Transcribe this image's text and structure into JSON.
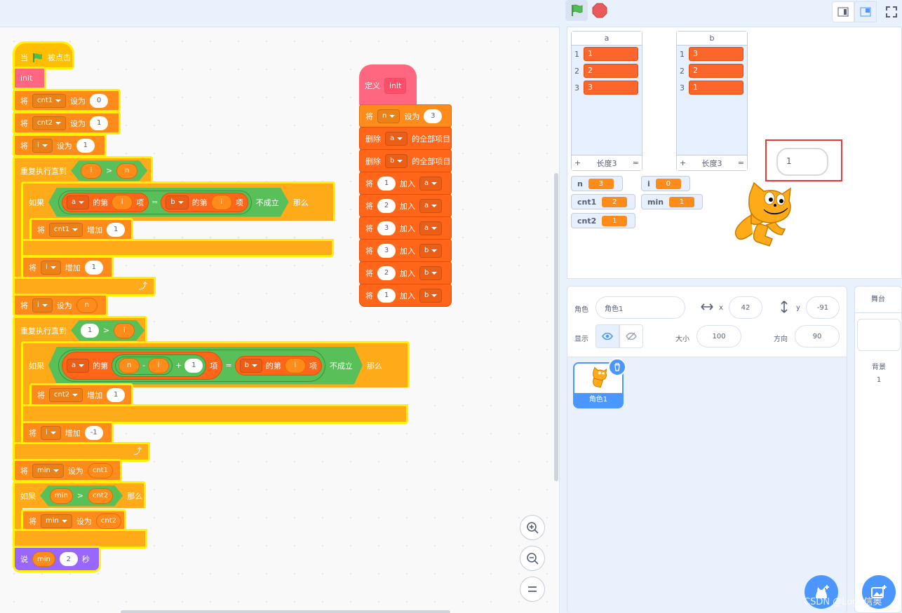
{
  "code": {
    "s1": {
      "hat": {
        "w1": "当",
        "w2": "被点击"
      },
      "init": "init",
      "set_cnt1": {
        "verb": "将",
        "var": "cnt1",
        "op": "设为",
        "val": "0"
      },
      "set_cnt2": {
        "verb": "将",
        "var": "cnt2",
        "op": "设为",
        "val": "1"
      },
      "set_i": {
        "verb": "将",
        "var": "i",
        "op": "设为",
        "val": "1"
      },
      "repeat1": {
        "label": "重复执行直到",
        "l": "i",
        "op": ">",
        "r": "n"
      },
      "if1": {
        "label": "如果",
        "lst": "a",
        "of": "的第",
        "idx": "i",
        "item": "项",
        "eq": "=",
        "lst2": "b",
        "of2": "的第",
        "idx2": "i",
        "item2": "项",
        "not": "不成立",
        "then": "那么"
      },
      "chg_cnt1": {
        "verb": "将",
        "var": "cnt1",
        "op": "增加",
        "val": "1"
      },
      "chg_i": {
        "verb": "将",
        "var": "i",
        "op": "增加",
        "val": "1"
      },
      "set_i_n": {
        "verb": "将",
        "var": "i",
        "op": "设为",
        "val": "n"
      },
      "repeat2": {
        "label": "重复执行直到",
        "l": "1",
        "op": ">",
        "r": "i"
      },
      "if2": {
        "label": "如果",
        "lst": "a",
        "of": "的第",
        "n": "n",
        "minus": "-",
        "i": "i",
        "plus": "+",
        "one": "1",
        "item": "项",
        "eq": "=",
        "lst2": "b",
        "of2": "的第",
        "idx2": "i",
        "item2": "项",
        "not": "不成立",
        "then": "那么"
      },
      "chg_cnt2": {
        "verb": "将",
        "var": "cnt2",
        "op": "增加",
        "val": "1"
      },
      "chg_i2": {
        "verb": "将",
        "var": "i",
        "op": "增加",
        "val": "-1"
      },
      "set_min": {
        "verb": "将",
        "var": "min",
        "op": "设为",
        "val": "cnt1"
      },
      "if3": {
        "label": "如果",
        "l": "min",
        "op": ">",
        "r": "cnt2",
        "then": "那么"
      },
      "set_min2": {
        "verb": "将",
        "var": "min",
        "op": "设为",
        "val": "cnt2"
      },
      "say": {
        "verb": "说",
        "val": "min",
        "secs": "2",
        "unit": "秒"
      }
    },
    "s2": {
      "define": {
        "label": "定义",
        "name": "init"
      },
      "set_n": {
        "verb": "将",
        "var": "n",
        "op": "设为",
        "val": "3"
      },
      "del_a": {
        "verb": "删除",
        "lst": "a",
        "tail": "的全部项目"
      },
      "del_b": {
        "verb": "删除",
        "lst": "b",
        "tail": "的全部项目"
      },
      "adds": [
        {
          "verb": "将",
          "val": "1",
          "op": "加入",
          "lst": "a"
        },
        {
          "verb": "将",
          "val": "2",
          "op": "加入",
          "lst": "a"
        },
        {
          "verb": "将",
          "val": "3",
          "op": "加入",
          "lst": "a"
        },
        {
          "verb": "将",
          "val": "3",
          "op": "加入",
          "lst": "b"
        },
        {
          "verb": "将",
          "val": "2",
          "op": "加入",
          "lst": "b"
        },
        {
          "verb": "将",
          "val": "1",
          "op": "加入",
          "lst": "b"
        }
      ]
    }
  },
  "stage": {
    "list_a": {
      "title": "a",
      "items": [
        "1",
        "2",
        "3"
      ],
      "idx": [
        "1",
        "2",
        "3"
      ],
      "plus": "+",
      "len": "长度3",
      "eq": "="
    },
    "list_b": {
      "title": "b",
      "items": [
        "3",
        "2",
        "1"
      ],
      "idx": [
        "1",
        "2",
        "3"
      ],
      "plus": "+",
      "len": "长度3",
      "eq": "="
    },
    "vars": [
      {
        "name": "n",
        "value": "3"
      },
      {
        "name": "i",
        "value": "0"
      },
      {
        "name": "cnt1",
        "value": "2"
      },
      {
        "name": "min",
        "value": "1"
      },
      {
        "name": "cnt2",
        "value": "1"
      }
    ],
    "bubble": "1"
  },
  "sprite": {
    "label_sprite": "角色",
    "name": "角色1",
    "x_label": "x",
    "x": "42",
    "y_label": "y",
    "y": "-91",
    "show_label": "显示",
    "size_label": "大小",
    "size": "100",
    "dir_label": "方向",
    "dir": "90",
    "thumb_name": "角色1"
  },
  "stage_panel": {
    "title": "舞台",
    "backdrops_label": "背景",
    "backdrops": "1"
  },
  "watermark": "CSDN @Loge信奥",
  "colors": {
    "motion_bg": "#e9f1fc",
    "control": "#ffab19",
    "variables": "#ff8c1a",
    "lists": "#ff661a",
    "operators": "#59c059",
    "myblocks": "#ff6680",
    "looks": "#9966ff",
    "highlight": "#fff200"
  }
}
